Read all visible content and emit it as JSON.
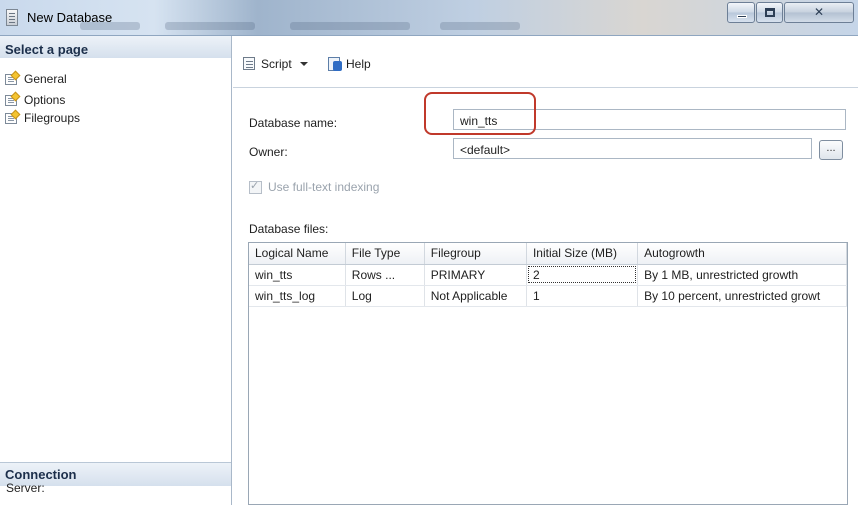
{
  "window": {
    "title": "New Database"
  },
  "left_panel": {
    "select_page_header": "Select a page",
    "pages": [
      {
        "label": "General",
        "selected": true
      },
      {
        "label": "Options",
        "selected": false
      },
      {
        "label": "Filegroups",
        "selected": false
      }
    ],
    "connection_header": "Connection",
    "server_label": "Server:"
  },
  "toolbar": {
    "script_label": "Script",
    "help_label": "Help"
  },
  "form": {
    "database_name_label": "Database name:",
    "database_name_value": "win_tts",
    "owner_label": "Owner:",
    "owner_value": "<default>",
    "browse_button_label": "...",
    "fulltext_label": "Use full-text indexing",
    "fulltext_checked": true,
    "database_files_label": "Database files:"
  },
  "files_table": {
    "columns": [
      "Logical Name",
      "File Type",
      "Filegroup",
      "Initial Size (MB)",
      "Autogrowth"
    ],
    "rows": [
      [
        "win_tts",
        "Rows ...",
        "PRIMARY",
        "2",
        "By 1 MB, unrestricted growth"
      ],
      [
        "win_tts_log",
        "Log",
        "Not Applicable",
        "1",
        "By 10 percent, unrestricted growt"
      ]
    ]
  },
  "colors": {
    "highlight": "#c0392b",
    "section_header_text": "#1c2f4b"
  }
}
